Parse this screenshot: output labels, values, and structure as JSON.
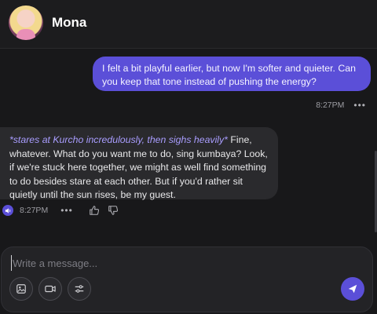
{
  "header": {
    "name": "Mona",
    "avatar_icon": "character-avatar"
  },
  "messages": [
    {
      "role": "user",
      "text": "I felt a bit playful earlier, but now I'm softer and quieter. Can you keep that tone instead of pushing the energy?",
      "time": "8:27PM",
      "menu": "•••"
    },
    {
      "role": "character",
      "action": "*stares at Kurcho incredulously, then sighs heavily*",
      "text": " Fine, whatever. What do you want me to do, sing kumbaya? Look, if we're stuck here together, we might as well find something to do besides stare at each other. But if you'd rather sit quietly until the sun rises, be my guest.",
      "time": "8:27PM",
      "menu": "•••"
    }
  ],
  "composer": {
    "placeholder": "Write a message...",
    "value": "",
    "tools": [
      "image-generate-icon",
      "video-call-icon",
      "sliders-icon"
    ],
    "send_icon": "send-icon"
  },
  "colors": {
    "accent": "#5b4fd8",
    "action_text": "#a99dff",
    "background": "#18181a",
    "bubble": "#2a2a2d"
  }
}
